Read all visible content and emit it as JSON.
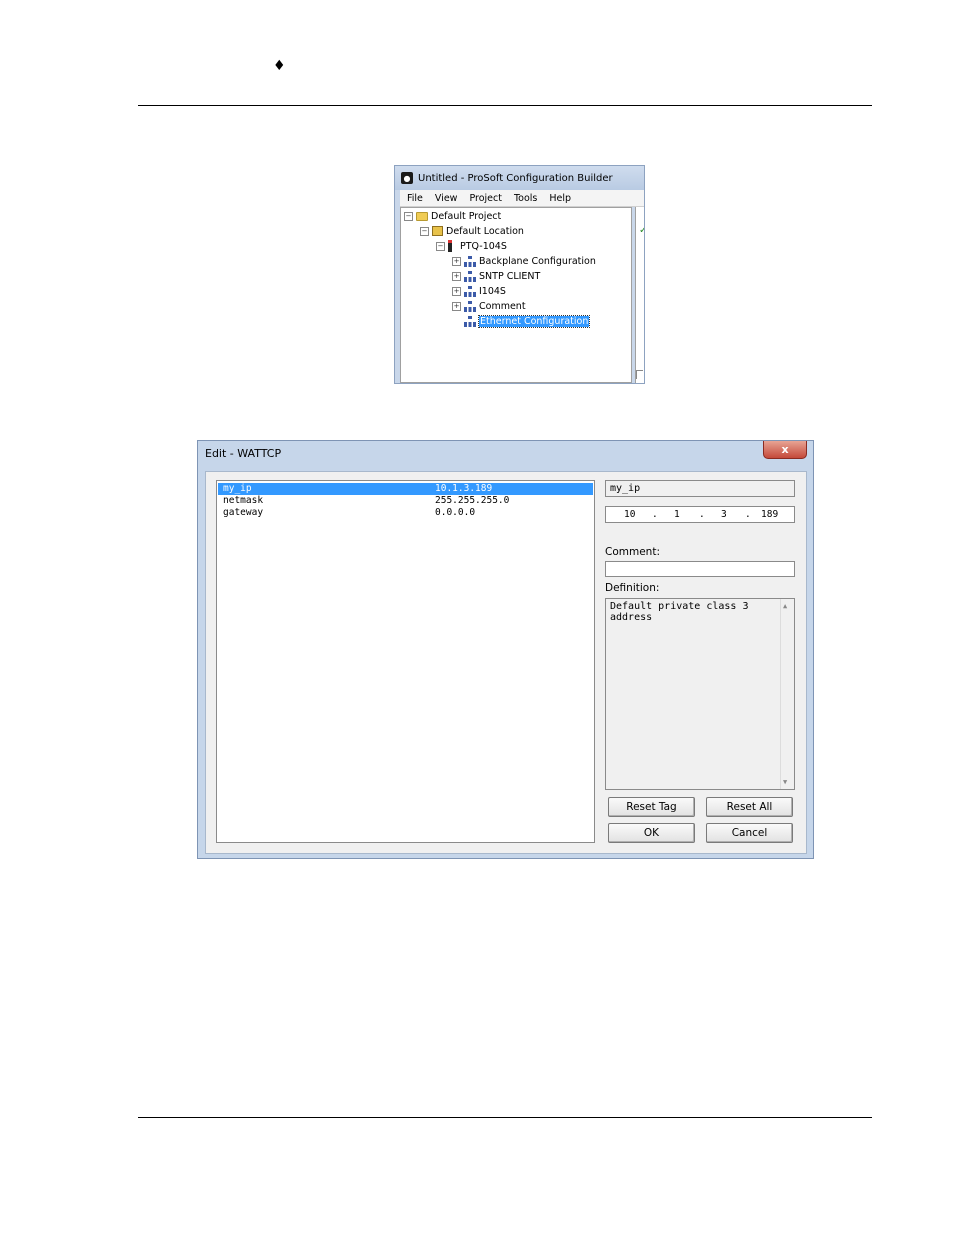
{
  "page": {
    "bullet": "♦"
  },
  "prosoft": {
    "title": "Untitled - ProSoft Configuration Builder",
    "menu": [
      "File",
      "View",
      "Project",
      "Tools",
      "Help"
    ],
    "tree": [
      {
        "label": "Default Project",
        "expander": "−",
        "icon": "folder"
      },
      {
        "label": "Default Location",
        "expander": "−",
        "icon": "location"
      },
      {
        "label": "PTQ-104S",
        "expander": "−",
        "icon": "device"
      },
      {
        "label": "Backplane Configuration",
        "expander": "+",
        "icon": "network"
      },
      {
        "label": "SNTP CLIENT",
        "expander": "+",
        "icon": "network"
      },
      {
        "label": "I104S",
        "expander": "+",
        "icon": "network"
      },
      {
        "label": "Comment",
        "expander": "+",
        "icon": "network"
      },
      {
        "label": "Ethernet Configuration",
        "expander": "",
        "icon": "network",
        "selected": true
      }
    ],
    "checkmark": "✓"
  },
  "dialog": {
    "title": "Edit - WATTCP",
    "close": "x",
    "rows": [
      {
        "name": "my_ip",
        "value": "10.1.3.189",
        "selected": true
      },
      {
        "name": "netmask",
        "value": "255.255.255.0"
      },
      {
        "name": "gateway",
        "value": "0.0.0.0"
      }
    ],
    "tag_name": "my_ip",
    "ip": {
      "o1": "10",
      "o2": "1",
      "o3": "3",
      "o4": "189",
      "dot": "."
    },
    "comment_label": "Comment:",
    "comment_value": "",
    "definition_label": "Definition:",
    "definition_text": "Default private class 3 address",
    "scroll_up": "▲",
    "scroll_down": "▼",
    "buttons": {
      "reset_tag": "Reset Tag",
      "reset_all": "Reset All",
      "ok": "OK",
      "cancel": "Cancel"
    }
  }
}
